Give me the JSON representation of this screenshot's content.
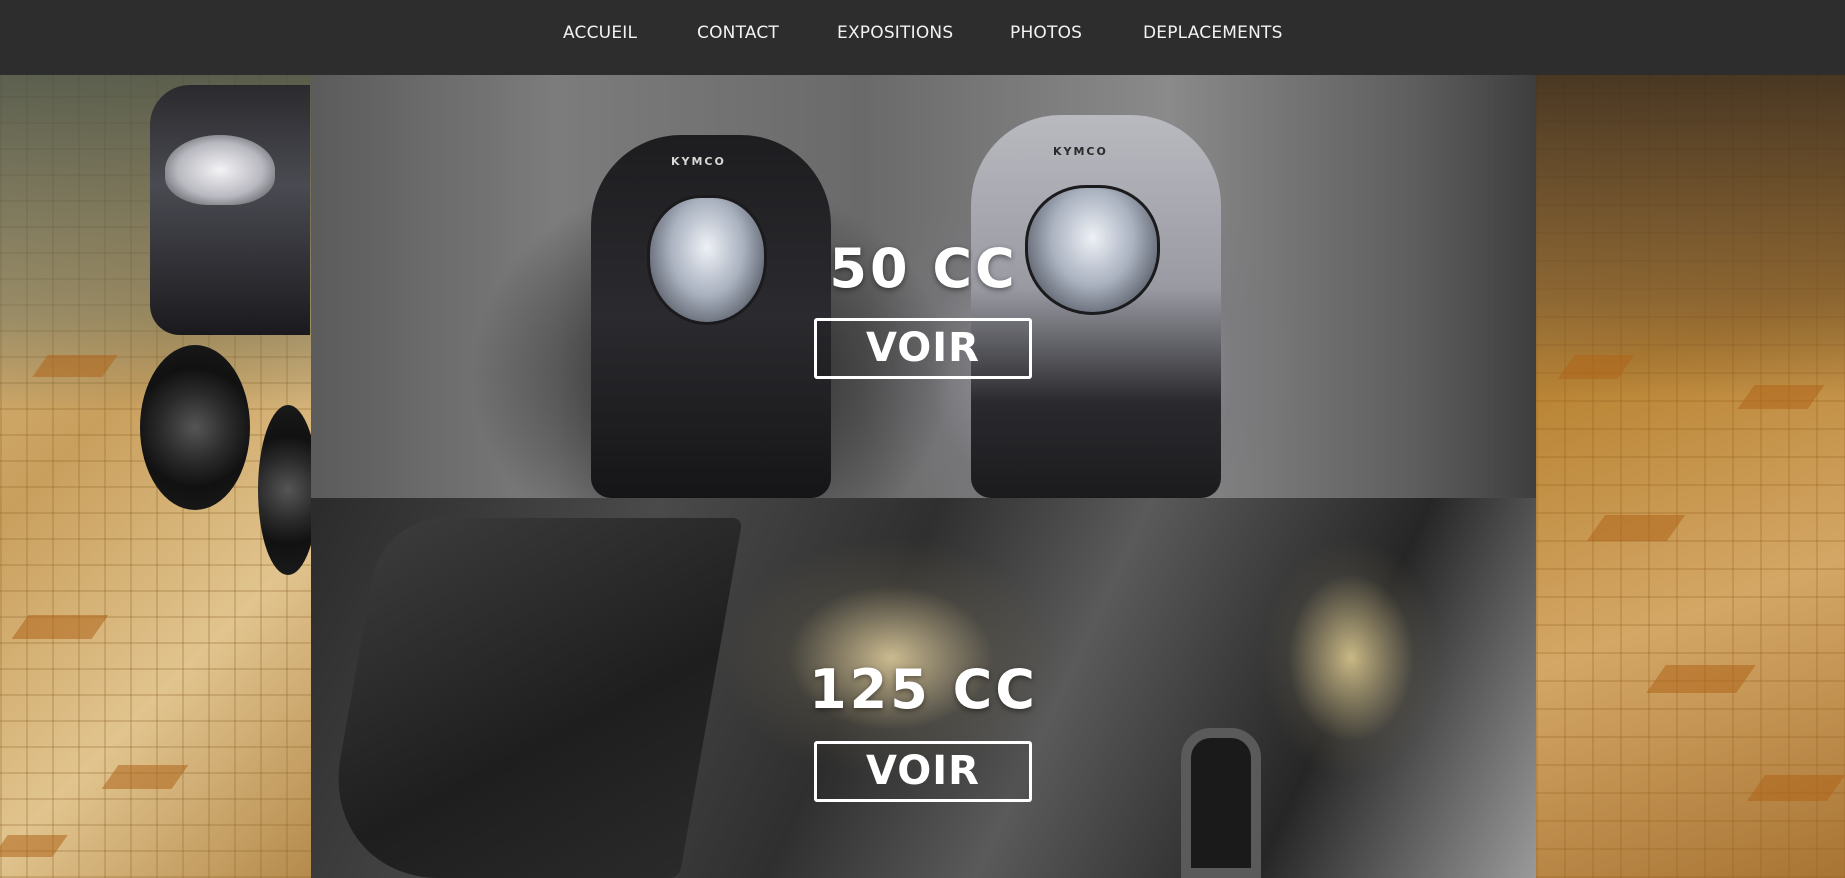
{
  "nav": {
    "items": [
      {
        "label": "ACCUEIL"
      },
      {
        "label": "CONTACT"
      },
      {
        "label": "EXPOSITIONS"
      },
      {
        "label": "PHOTOS"
      },
      {
        "label": "DEPLACEMENTS"
      }
    ]
  },
  "panels": [
    {
      "title": "50 CC",
      "button_label": "VOIR",
      "brand": "KYMCO"
    },
    {
      "title": "125 CC",
      "button_label": "VOIR"
    }
  ],
  "colors": {
    "nav_background": "#2d2d2d",
    "nav_text": "#f2f2f2",
    "button_border": "#ffffff",
    "title_text": "#ffffff"
  }
}
